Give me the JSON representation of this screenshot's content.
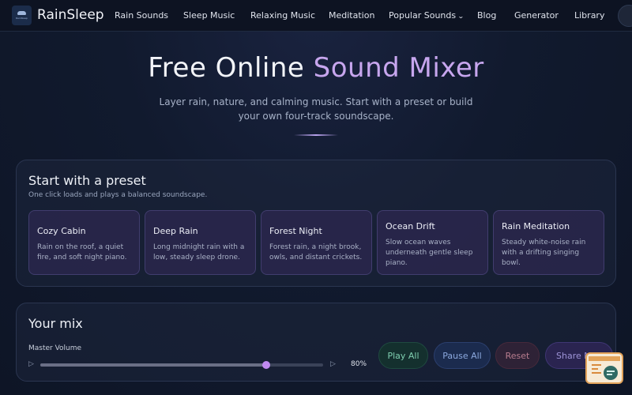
{
  "header": {
    "brand": "RainSleep",
    "logo_text": "RainSleep",
    "nav": [
      {
        "label": "Rain Sounds"
      },
      {
        "label": "Sleep Music"
      },
      {
        "label": "Relaxing Music"
      },
      {
        "label": "Meditation"
      },
      {
        "label": "Popular Sounds",
        "has_dropdown": true
      },
      {
        "label": "Blog"
      },
      {
        "label": "Generator"
      },
      {
        "label": "Library"
      }
    ]
  },
  "hero": {
    "title_main": "Free Online ",
    "title_accent": "Sound Mixer",
    "subtitle": "Layer rain, nature, and calming music. Start with a preset or build your own four-track soundscape."
  },
  "presets": {
    "title": "Start with a preset",
    "subtitle": "One click loads and plays a balanced soundscape.",
    "items": [
      {
        "name": "Cozy Cabin",
        "desc": "Rain on the roof, a quiet fire, and soft night piano."
      },
      {
        "name": "Deep Rain",
        "desc": "Long midnight rain with a low, steady sleep drone."
      },
      {
        "name": "Forest Night",
        "desc": "Forest rain, a night brook, owls, and distant crickets."
      },
      {
        "name": "Ocean Drift",
        "desc": "Slow ocean waves underneath gentle sleep piano."
      },
      {
        "name": "Rain Meditation",
        "desc": "Steady white-noise rain with a drifting singing bowl."
      }
    ]
  },
  "mix": {
    "title": "Your mix",
    "master_label": "Master Volume",
    "volume_low_icon": "volume-low-icon",
    "volume_high_icon": "volume-high-icon",
    "volume_value": 0.8,
    "volume_text": "80%",
    "buttons": {
      "play": "Play All",
      "pause": "Pause All",
      "reset": "Reset",
      "share": "Share Mix"
    }
  },
  "colors": {
    "accent": "#c7a6ee",
    "thumb": "#c08af0",
    "play": "#7fcfb0",
    "pause": "#8ba8de",
    "reset": "#b77c8e",
    "share": "#9d93d6"
  }
}
